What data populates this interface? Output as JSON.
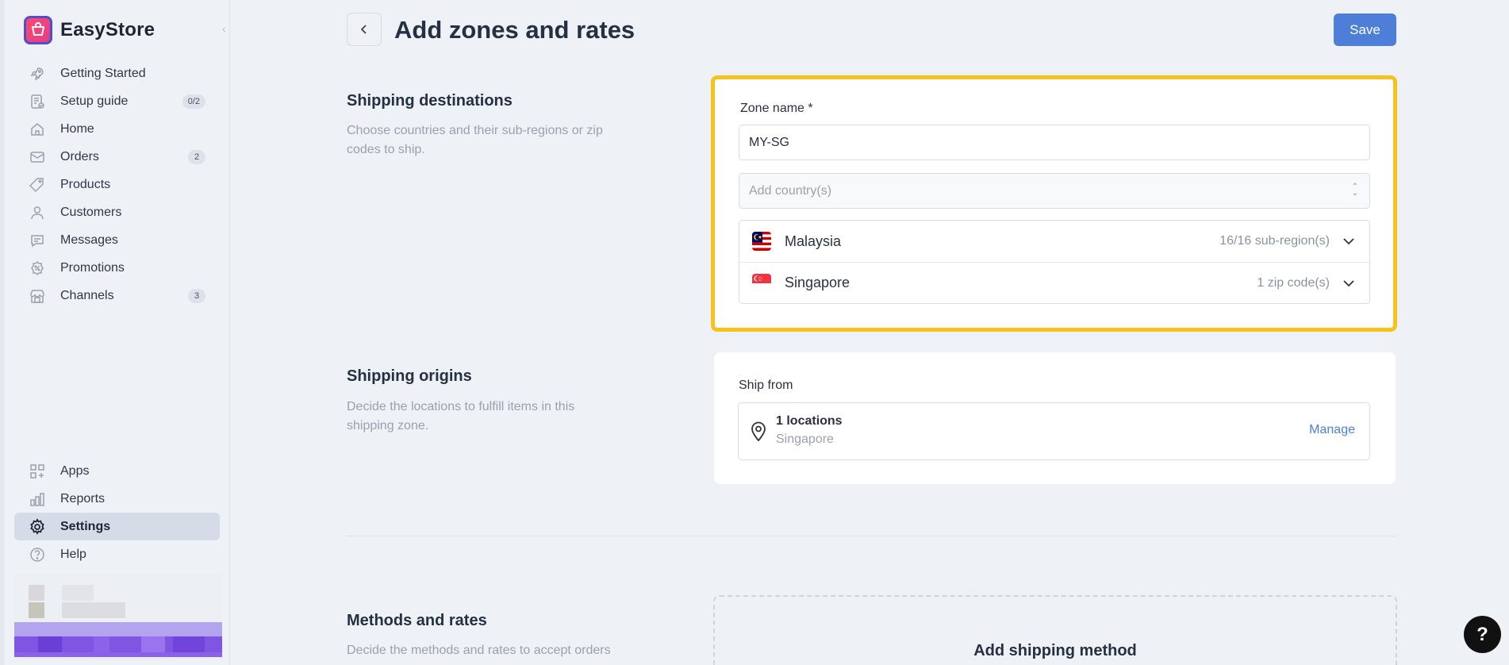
{
  "app": {
    "name": "EasyStore"
  },
  "sidebar": {
    "items": [
      {
        "label": "Getting Started",
        "icon": "rocket-icon"
      },
      {
        "label": "Setup guide",
        "icon": "checklist-icon",
        "badge": "0/2"
      },
      {
        "label": "Home",
        "icon": "home-icon"
      },
      {
        "label": "Orders",
        "icon": "inbox-icon",
        "badge": "2"
      },
      {
        "label": "Products",
        "icon": "tag-icon"
      },
      {
        "label": "Customers",
        "icon": "user-icon"
      },
      {
        "label": "Messages",
        "icon": "chat-icon"
      },
      {
        "label": "Promotions",
        "icon": "promotion-icon"
      },
      {
        "label": "Channels",
        "icon": "store-icon",
        "badge": "3"
      }
    ],
    "bottom_items": [
      {
        "label": "Apps",
        "icon": "apps-icon"
      },
      {
        "label": "Reports",
        "icon": "chart-icon"
      },
      {
        "label": "Settings",
        "icon": "gear-icon",
        "active": true
      },
      {
        "label": "Help",
        "icon": "help-icon"
      }
    ]
  },
  "header": {
    "title": "Add zones and rates",
    "save_label": "Save"
  },
  "shipping_destinations": {
    "title": "Shipping destinations",
    "description": "Choose countries and their sub-regions or zip codes to ship.",
    "zone_name_label": "Zone name *",
    "zone_name_value": "MY-SG",
    "country_placeholder": "Add country(s)",
    "countries": [
      {
        "name": "Malaysia",
        "meta": "16/16 sub-region(s)"
      },
      {
        "name": "Singapore",
        "meta": "1 zip code(s)"
      }
    ]
  },
  "shipping_origins": {
    "title": "Shipping origins",
    "description": "Decide the locations to fulfill items in this shipping zone.",
    "ship_from_label": "Ship from",
    "locations_title": "1 locations",
    "locations_sub": "Singapore",
    "manage_label": "Manage"
  },
  "methods_rates": {
    "title": "Methods and rates",
    "description": "Decide the methods and rates to accept orders",
    "add_method_label": "Add shipping method"
  },
  "help_fab": "?",
  "colors": {
    "primary": "#4e7fd8",
    "highlight": "#f7c31a",
    "background": "#eef1f6"
  }
}
